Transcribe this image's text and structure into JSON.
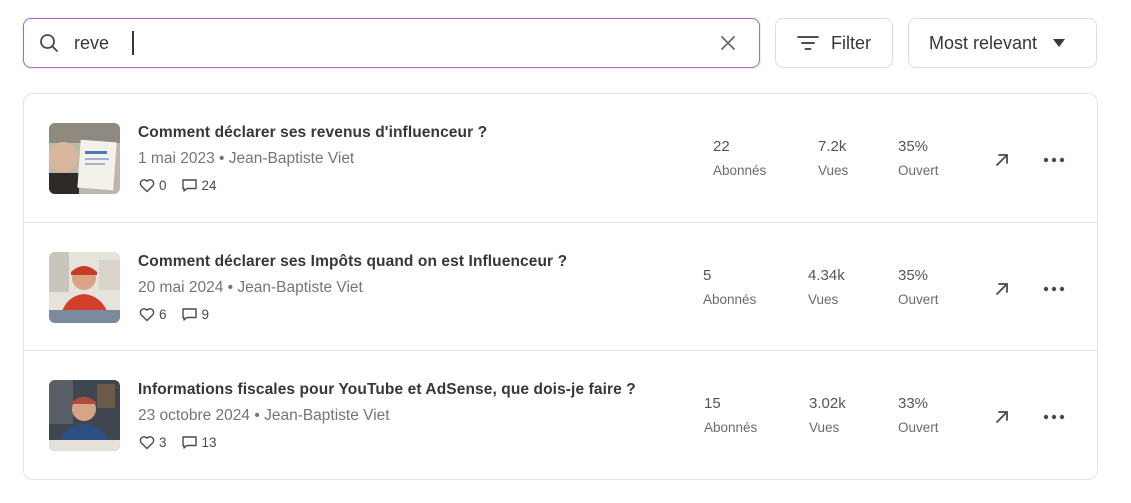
{
  "search": {
    "value": "reve",
    "icon": "search-icon",
    "clear_icon": "close-icon"
  },
  "filter": {
    "label": "Filter",
    "icon": "filter-icon"
  },
  "sort": {
    "label": "Most relevant",
    "icon": "caret-down-icon"
  },
  "posts": [
    {
      "title": "Comment déclarer ses revenus d'influenceur ?",
      "meta": "1 mai 2023 • Jean-Baptiste Viet",
      "likes": "0",
      "comments": "24",
      "subscribers": "22",
      "subscribers_label": "Abonnés",
      "views": "7.2k",
      "views_label": "Vues",
      "open_rate": "35%",
      "open_label": "Ouvert",
      "thumb_colors": [
        "#c9c2b6",
        "#f4f1ea",
        "#3a3630"
      ]
    },
    {
      "title": "Comment déclarer ses Impôts quand on est Influenceur ?",
      "meta": "20 mai 2024 • Jean-Baptiste Viet",
      "likes": "6",
      "comments": "9",
      "subscribers": "5",
      "subscribers_label": "Abonnés",
      "views": "4.34k",
      "views_label": "Vues",
      "open_rate": "35%",
      "open_label": "Ouvert",
      "thumb_colors": [
        "#e9e6e0",
        "#d2402c",
        "#5a6c86"
      ]
    },
    {
      "title": "Informations fiscales pour YouTube et AdSense, que dois-je faire ?",
      "meta": "23 octobre 2024 • Jean-Baptiste Viet",
      "likes": "3",
      "comments": "13",
      "subscribers": "15",
      "subscribers_label": "Abonnés",
      "views": "3.02k",
      "views_label": "Vues",
      "open_rate": "33%",
      "open_label": "Ouvert",
      "thumb_colors": [
        "#3f4650",
        "#2c4e86",
        "#c95a4a"
      ]
    }
  ],
  "colors": {
    "accent": "#a869d8",
    "text": "#363737",
    "muted": "#757575",
    "border": "#e3e3e3"
  }
}
